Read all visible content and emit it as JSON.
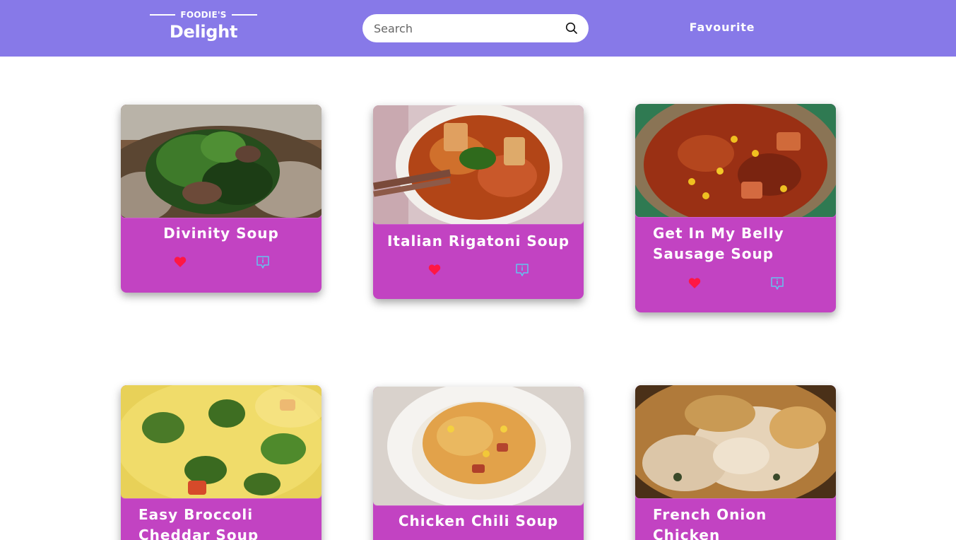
{
  "header": {
    "logo_tagline": "FOODIE'S",
    "logo_name": "Delight",
    "search_placeholder": "Search",
    "favourite_label": "Favourite"
  },
  "recipes": [
    {
      "title": "Divinity Soup"
    },
    {
      "title": "Italian Rigatoni Soup"
    },
    {
      "title": "Get In My Belly Sausage Soup"
    },
    {
      "title": "Easy Broccoli Cheddar Soup"
    },
    {
      "title": "Chicken Chili Soup"
    },
    {
      "title": "French Onion Chicken"
    }
  ],
  "icons": {
    "favourite": "heart-icon",
    "details": "info-message-icon",
    "search": "search-icon"
  },
  "colors": {
    "navbar": "#8779e8",
    "card": "#c243c2",
    "heart": "#ff1744",
    "info": "#62c6f0"
  }
}
